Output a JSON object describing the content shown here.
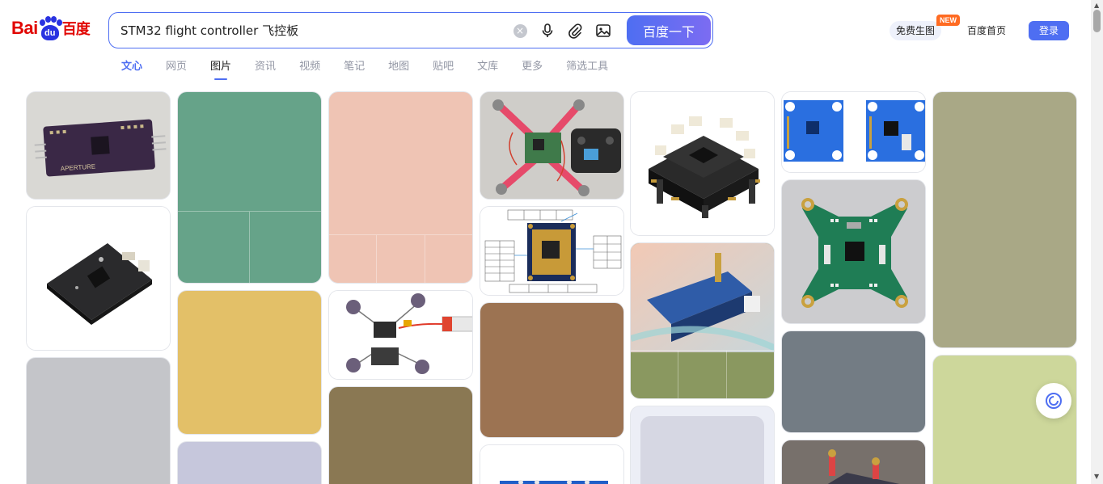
{
  "logo": {
    "bai": "Bai",
    "du": "du",
    "cn": "百度"
  },
  "search": {
    "query": "STM32 flight controller 飞控板",
    "clear_glyph": "×",
    "button_label": "百度一下"
  },
  "header": {
    "free_image": "免费生图",
    "new_badge": "NEW",
    "home": "百度首页",
    "login": "登录"
  },
  "tabs": [
    {
      "label": "文心"
    },
    {
      "label": "网页"
    },
    {
      "label": "图片"
    },
    {
      "label": "资讯"
    },
    {
      "label": "视频"
    },
    {
      "label": "笔记"
    },
    {
      "label": "地图"
    },
    {
      "label": "贴吧"
    },
    {
      "label": "文库"
    },
    {
      "label": "更多"
    },
    {
      "label": "筛选工具"
    }
  ],
  "images": {
    "c1_1": {
      "label": "APERTURE"
    },
    "placeholder_colors": {
      "green": "#66a389",
      "peach": "#efc4b4",
      "gold": "#e3c068",
      "lavender": "#c6c7dc",
      "grey": "#c4c5c9",
      "olive_brown": "#8a7853",
      "brown": "#9c7352",
      "olive_green": "#8a9860",
      "slate": "#737c84",
      "khaki": "#a9a886",
      "lime": "#cdd79b",
      "pale": "#d6d7e3"
    }
  },
  "icons": {
    "clear": "clear-icon",
    "mic": "microphone-icon",
    "attach": "paperclip-icon",
    "image_search": "image-icon",
    "float": "assistant-icon"
  },
  "colors": {
    "brand_blue": "#4e6ef2",
    "brand_red": "#e10602"
  }
}
